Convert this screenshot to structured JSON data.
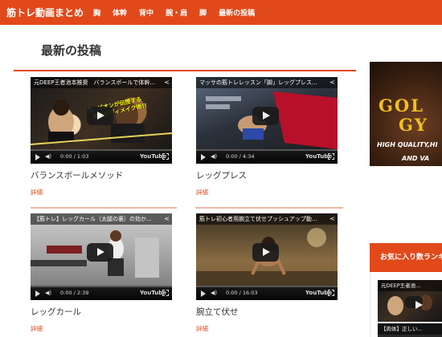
{
  "header": {
    "site_title": "筋トレ動画まとめ",
    "nav": [
      "胸",
      "体幹",
      "背中",
      "腕・肩",
      "脚",
      "最新の投稿"
    ]
  },
  "main": {
    "section_title": "最新の投稿",
    "more_label": "詳細",
    "cards": [
      {
        "video_title": "元DEEP王者池本推奨　バランスボールで体幹...",
        "time": "0:00 / 1:03",
        "title": "バランスボールメソッド",
        "thumb": "fighter"
      },
      {
        "video_title": "マッサの筋トレレッスン「脚」レッグプレス...",
        "time": "0:00 / 4:34",
        "title": "レッグプレス",
        "thumb": "gym"
      },
      {
        "video_title": "【筋トレ】レッグカール（太腿の裏）の効か...",
        "time": "0:00 / 2:39",
        "title": "レッグカール",
        "thumb": "legcurl"
      },
      {
        "video_title": "筋トレ初心者用腕立て伏せプッシュアップ動...",
        "time": "0:00 / 16:03",
        "title": "腕立て伏せ",
        "thumb": "pushup"
      }
    ],
    "overlay_text": [
      "元",
      "ピオンが伝授する",
      "最短ボディメイク術!!"
    ]
  },
  "sidebar": {
    "banner": {
      "brand_1": "GOL",
      "brand_2": "GY",
      "tagline_1": "HIGH QUALITY,HI",
      "tagline_2": "AND VA"
    },
    "favorites_title": "お気に入り数ランキング",
    "fav_videos": [
      {
        "video_title": "元DEEP王者池..."
      },
      {
        "video_title": "【肉体】正しい..."
      }
    ]
  },
  "player": {
    "logo": "YouTube"
  },
  "colors": {
    "accent": "#e2491a",
    "divider": "#f0b7a4",
    "more_link": "#e2491a"
  }
}
